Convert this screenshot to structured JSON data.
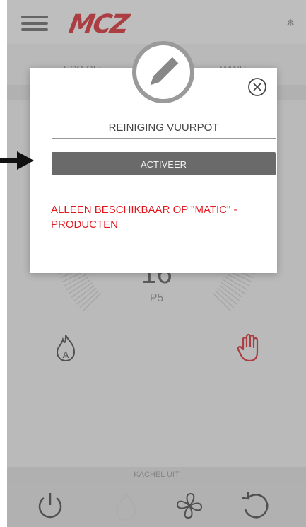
{
  "app": {
    "brand": "MCZ",
    "brand_color": "#c4151c"
  },
  "tabs": {
    "left_label": "ECO OFF",
    "right_label": "MANU"
  },
  "dial": {
    "value": "16",
    "power_label": "P5",
    "accent_color": "#c4151c"
  },
  "status": {
    "text": "KACHEL UIT"
  },
  "modal": {
    "header_icon": "pencil-icon",
    "close_icon": "close-circle-icon",
    "title": "REINIGING VUURPOT",
    "button_label": "ACTIVEER",
    "warning_text": "ALLEEN BESCHIKBAAR OP \"MATIC\" - PRODUCTEN",
    "warning_color": "#e3181f"
  },
  "bottom_nav": {
    "icons": [
      "power-icon",
      "flame-icon",
      "fan-icon",
      "refresh-icon"
    ]
  }
}
